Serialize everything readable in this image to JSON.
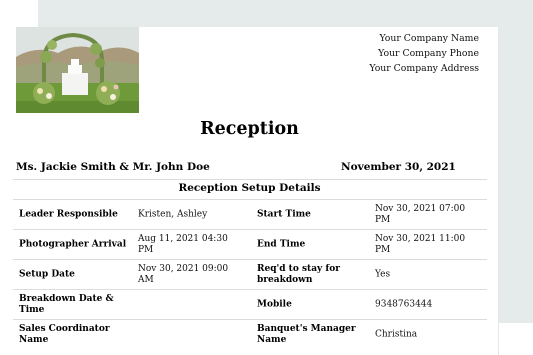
{
  "company": {
    "name": "Your Company Name",
    "phone": "Your Company Phone",
    "address": "Your Company Address"
  },
  "title": "Reception",
  "couple": "Ms. Jackie Smith & Mr. John Doe",
  "event_date": "November 30, 2021",
  "section_title": "Reception Setup Details",
  "rows": [
    {
      "label1": "Leader Responsible",
      "value1": "Kristen, Ashley",
      "label2": "Start Time",
      "value2": "Nov 30, 2021 07:00 PM"
    },
    {
      "label1": "Photographer Arrival",
      "value1": "Aug 11, 2021 04:30 PM",
      "label2": "End Time",
      "value2": "Nov 30, 2021 11:00 PM"
    },
    {
      "label1": "Setup Date",
      "value1": "Nov 30, 2021 09:00 AM",
      "label2": "Req'd to stay for breakdown",
      "value2": "Yes"
    },
    {
      "label1": "Breakdown Date & Time",
      "value1": "",
      "label2": "Mobile",
      "value2": "9348763444"
    },
    {
      "label1": "Sales Coordinator Name",
      "value1": "",
      "label2": "Banquet's Manager Name",
      "value2": "Christina"
    }
  ]
}
